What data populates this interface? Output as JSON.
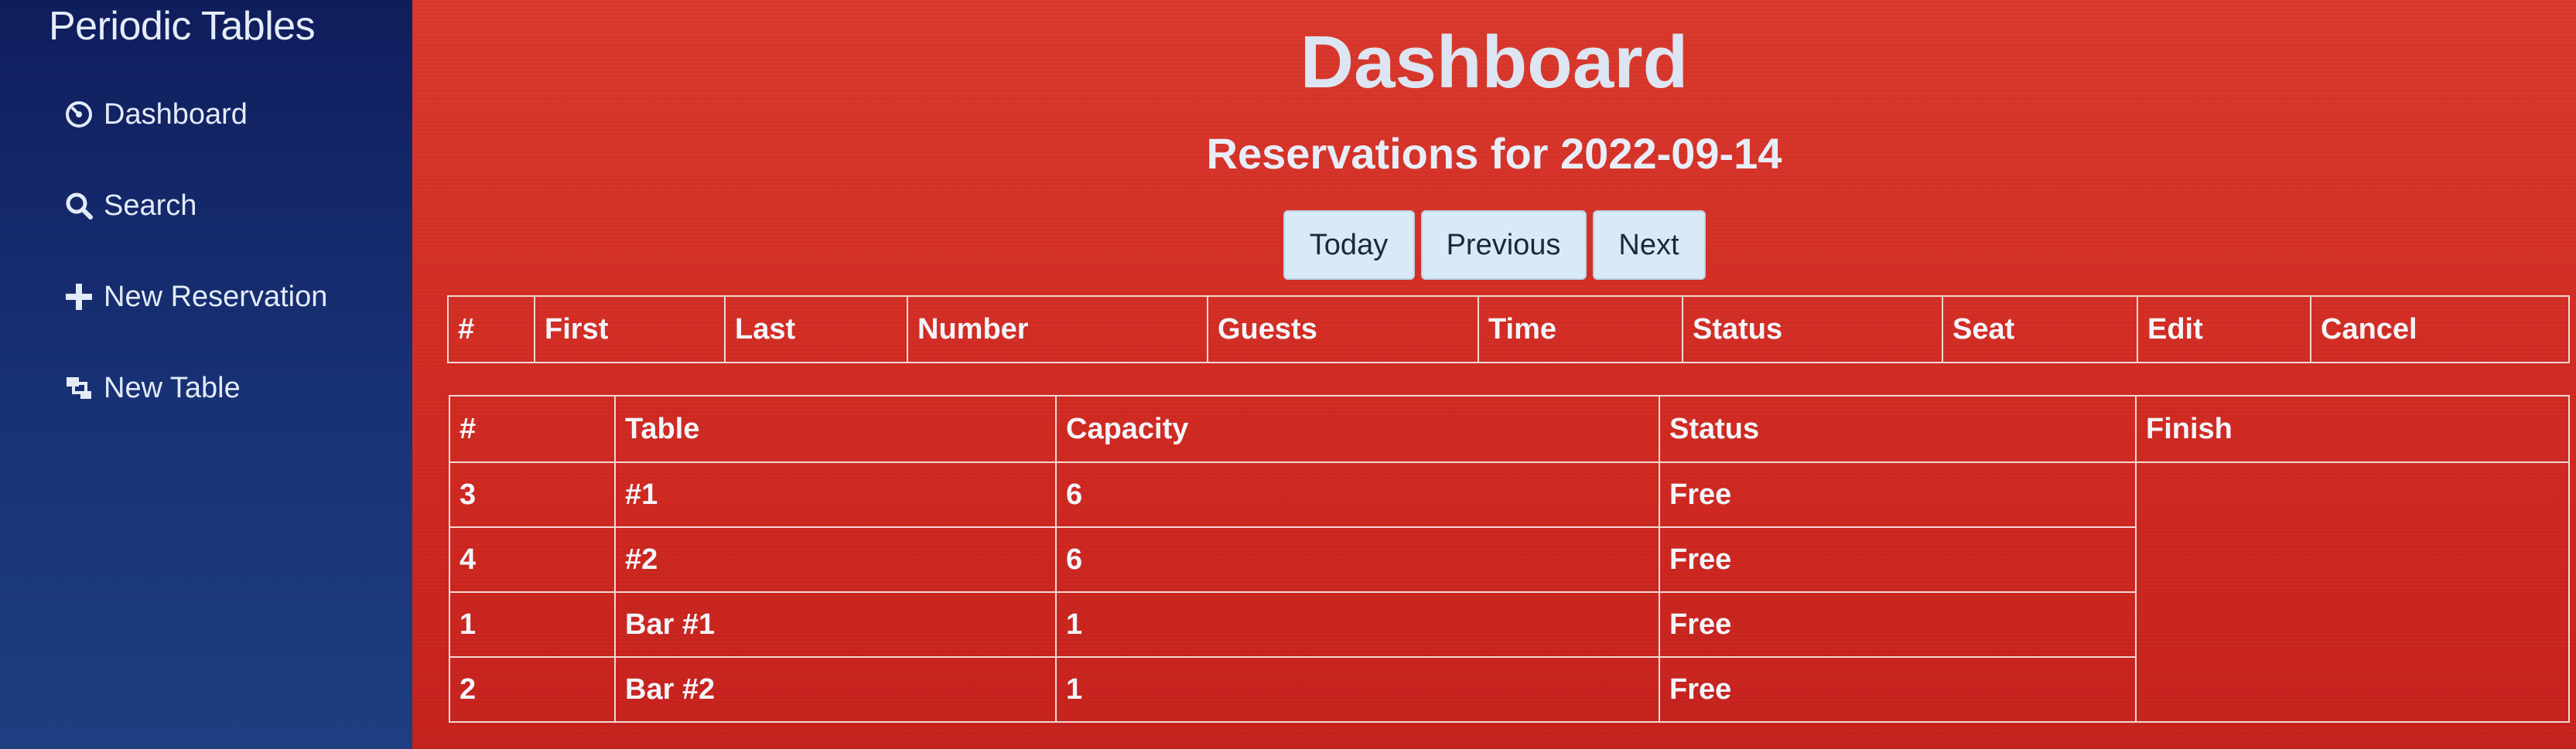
{
  "sidebar": {
    "brand": "Periodic Tables",
    "items": [
      {
        "label": "Dashboard",
        "icon": "dashboard-icon"
      },
      {
        "label": "Search",
        "icon": "search-icon"
      },
      {
        "label": "New Reservation",
        "icon": "plus-icon"
      },
      {
        "label": "New Table",
        "icon": "layers-icon"
      }
    ]
  },
  "main": {
    "title": "Dashboard",
    "subtitle": "Reservations for 2022-09-14",
    "buttons": {
      "today": "Today",
      "previous": "Previous",
      "next": "Next"
    },
    "reservations": {
      "columns": [
        "#",
        "First",
        "Last",
        "Number",
        "Guests",
        "Time",
        "Status",
        "Seat",
        "Edit",
        "Cancel"
      ],
      "rows": []
    },
    "tables": {
      "columns": [
        "#",
        "Table",
        "Capacity",
        "Status",
        "Finish"
      ],
      "rows": [
        {
          "id": "3",
          "table": "#1",
          "capacity": "6",
          "status": "Free"
        },
        {
          "id": "4",
          "table": "#2",
          "capacity": "6",
          "status": "Free"
        },
        {
          "id": "1",
          "table": "Bar #1",
          "capacity": "1",
          "status": "Free"
        },
        {
          "id": "2",
          "table": "Bar #2",
          "capacity": "1",
          "status": "Free"
        }
      ]
    }
  },
  "colors": {
    "sidebar_bg": "#142a6c",
    "main_bg": "#d8322a",
    "button_bg": "#d8eaf6",
    "text_light": "#e6edf8"
  }
}
